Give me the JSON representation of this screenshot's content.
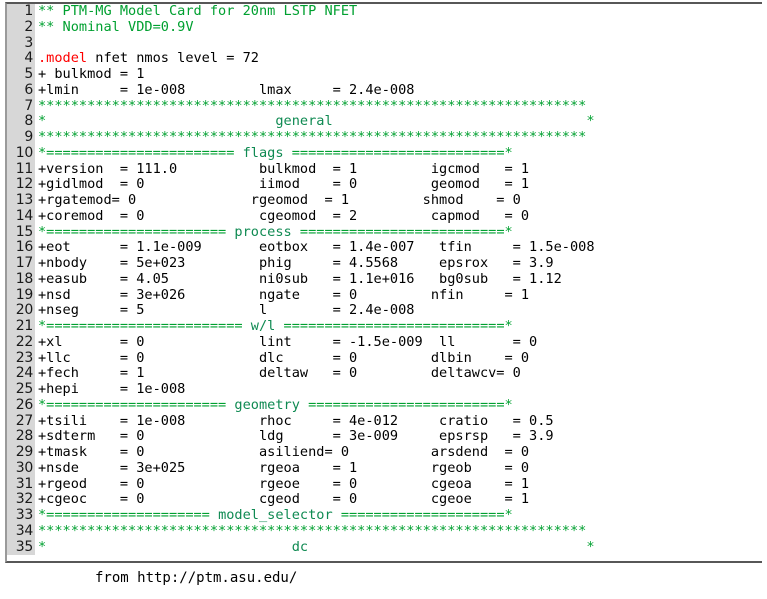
{
  "editor": {
    "colors": {
      "comment_green": "#00a030",
      "section_green": "#0f8a52",
      "keyword_red": "#ff0000",
      "gutter_bg": "#d7d7d7",
      "frame_border": "#575757",
      "background": "#ffffff"
    },
    "lines": [
      {
        "num": "1",
        "segments": [
          {
            "cls": "c-comment",
            "text": "** PTM-MG Model Card for 20nm LSTP NFET"
          }
        ]
      },
      {
        "num": "2",
        "segments": [
          {
            "cls": "c-comment",
            "text": "** Nominal VDD=0.9V"
          }
        ]
      },
      {
        "num": "3",
        "segments": [
          {
            "cls": "c-plain",
            "text": ""
          }
        ]
      },
      {
        "num": "4",
        "segments": [
          {
            "cls": "c-keyword",
            "text": ".model"
          },
          {
            "cls": "c-plain",
            "text": " nfet nmos level = 72"
          }
        ]
      },
      {
        "num": "5",
        "segments": [
          {
            "cls": "c-plain",
            "text": "+ bulkmod = 1"
          }
        ]
      },
      {
        "num": "6",
        "segments": [
          {
            "cls": "c-plain",
            "text": "+lmin     = 1e-008         lmax     = 2.4e-008"
          }
        ]
      },
      {
        "num": "7",
        "segments": [
          {
            "cls": "c-comment",
            "text": "*******************************************************************"
          }
        ]
      },
      {
        "num": "8",
        "segments": [
          {
            "cls": "c-comment",
            "text": "*"
          },
          {
            "cls": "c-plain",
            "text": "                            "
          },
          {
            "cls": "c-section",
            "text": "general"
          },
          {
            "cls": "c-plain",
            "text": "                               "
          },
          {
            "cls": "c-comment",
            "text": "*"
          }
        ]
      },
      {
        "num": "9",
        "segments": [
          {
            "cls": "c-comment",
            "text": "*******************************************************************"
          }
        ]
      },
      {
        "num": "10",
        "segments": [
          {
            "cls": "c-comment",
            "text": "*======================= "
          },
          {
            "cls": "c-section",
            "text": "flags"
          },
          {
            "cls": "c-comment",
            "text": " ==========================*"
          }
        ]
      },
      {
        "num": "11",
        "segments": [
          {
            "cls": "c-plain",
            "text": "+version  = 111.0          bulkmod  = 1         igcmod   = 1"
          }
        ]
      },
      {
        "num": "12",
        "segments": [
          {
            "cls": "c-plain",
            "text": "+gidlmod  = 0              iimod    = 0         geomod   = 1"
          }
        ]
      },
      {
        "num": "13",
        "segments": [
          {
            "cls": "c-plain",
            "text": "+rgatemod= 0              rgeomod  = 1         shmod    = 0"
          }
        ]
      },
      {
        "num": "14",
        "segments": [
          {
            "cls": "c-plain",
            "text": "+coremod  = 0              cgeomod  = 2         capmod   = 0"
          }
        ]
      },
      {
        "num": "15",
        "segments": [
          {
            "cls": "c-comment",
            "text": "*====================== "
          },
          {
            "cls": "c-section",
            "text": "process"
          },
          {
            "cls": "c-comment",
            "text": " =========================*"
          }
        ]
      },
      {
        "num": "16",
        "segments": [
          {
            "cls": "c-plain",
            "text": "+eot      = 1.1e-009       eotbox   = 1.4e-007   tfin     = 1.5e-008"
          }
        ]
      },
      {
        "num": "17",
        "segments": [
          {
            "cls": "c-plain",
            "text": "+nbody    = 5e+023         phig     = 4.5568     epsrox   = 3.9"
          }
        ]
      },
      {
        "num": "18",
        "segments": [
          {
            "cls": "c-plain",
            "text": "+easub    = 4.05           ni0sub   = 1.1e+016   bg0sub   = 1.12"
          }
        ]
      },
      {
        "num": "19",
        "segments": [
          {
            "cls": "c-plain",
            "text": "+nsd      = 3e+026         ngate    = 0         nfin     = 1"
          }
        ]
      },
      {
        "num": "20",
        "segments": [
          {
            "cls": "c-plain",
            "text": "+nseg     = 5              l        = 2.4e-008"
          }
        ]
      },
      {
        "num": "21",
        "segments": [
          {
            "cls": "c-comment",
            "text": "*======================== "
          },
          {
            "cls": "c-section",
            "text": "w/l"
          },
          {
            "cls": "c-comment",
            "text": " ===========================*"
          }
        ]
      },
      {
        "num": "22",
        "segments": [
          {
            "cls": "c-plain",
            "text": "+xl       = 0              lint     = -1.5e-009  ll       = 0"
          }
        ]
      },
      {
        "num": "23",
        "segments": [
          {
            "cls": "c-plain",
            "text": "+llc      = 0              dlc      = 0         dlbin    = 0"
          }
        ]
      },
      {
        "num": "24",
        "segments": [
          {
            "cls": "c-plain",
            "text": "+fech     = 1              deltaw   = 0         deltawcv= 0"
          }
        ]
      },
      {
        "num": "25",
        "segments": [
          {
            "cls": "c-plain",
            "text": "+hepi     = 1e-008"
          }
        ]
      },
      {
        "num": "26",
        "segments": [
          {
            "cls": "c-comment",
            "text": "*====================== "
          },
          {
            "cls": "c-section",
            "text": "geometry"
          },
          {
            "cls": "c-comment",
            "text": " ========================*"
          }
        ]
      },
      {
        "num": "27",
        "segments": [
          {
            "cls": "c-plain",
            "text": "+tsili    = 1e-008         rhoc     = 4e-012     cratio   = 0.5"
          }
        ]
      },
      {
        "num": "28",
        "segments": [
          {
            "cls": "c-plain",
            "text": "+sdterm   = 0              ldg      = 3e-009     epsrsp   = 3.9"
          }
        ]
      },
      {
        "num": "29",
        "segments": [
          {
            "cls": "c-plain",
            "text": "+tmask    = 0              asiliend= 0          arsdend  = 0"
          }
        ]
      },
      {
        "num": "30",
        "segments": [
          {
            "cls": "c-plain",
            "text": "+nsde     = 3e+025         rgeoa    = 1         rgeob    = 0"
          }
        ]
      },
      {
        "num": "31",
        "segments": [
          {
            "cls": "c-plain",
            "text": "+rgeod    = 0              rgeoe    = 0         cgeoa    = 1"
          }
        ]
      },
      {
        "num": "32",
        "segments": [
          {
            "cls": "c-plain",
            "text": "+cgeoc    = 0              cgeod    = 0         cgeoe    = 1"
          }
        ]
      },
      {
        "num": "33",
        "segments": [
          {
            "cls": "c-comment",
            "text": "*==================== "
          },
          {
            "cls": "c-section",
            "text": "model_selector"
          },
          {
            "cls": "c-comment",
            "text": " ====================*"
          }
        ]
      },
      {
        "num": "34",
        "segments": [
          {
            "cls": "c-comment",
            "text": "*******************************************************************"
          }
        ]
      },
      {
        "num": "35",
        "segments": [
          {
            "cls": "c-comment",
            "text": "*"
          },
          {
            "cls": "c-plain",
            "text": "                              "
          },
          {
            "cls": "c-section",
            "text": "dc"
          },
          {
            "cls": "c-plain",
            "text": "                                  "
          },
          {
            "cls": "c-comment",
            "text": "*"
          }
        ]
      }
    ]
  },
  "caption": {
    "text": "from http://ptm.asu.edu/"
  }
}
